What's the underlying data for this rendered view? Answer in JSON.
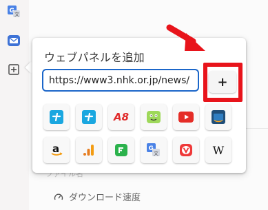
{
  "popup": {
    "title": "ウェブパネルを追加",
    "url_value": "https://www3.nhk.or.jp/news/",
    "add_label": "+"
  },
  "grid": {
    "row1": [
      "tile-1",
      "tile-2",
      "tile-3",
      "tile-4",
      "tile-5",
      "tile-6"
    ],
    "a6_text": "A8",
    "amazon_letter": "a",
    "wiki_text": "W"
  },
  "background": {
    "faded_label": "ファイル名",
    "download_speed_label": "ダウンロード速度"
  },
  "colors": {
    "input_border": "#1b66c9",
    "highlight_red": "#e8141b",
    "arrow_red": "#e8141b"
  },
  "icons": [
    "translate-icon",
    "mail-icon",
    "add-panel-icon",
    "plus-icon",
    "download-speed-icon"
  ]
}
